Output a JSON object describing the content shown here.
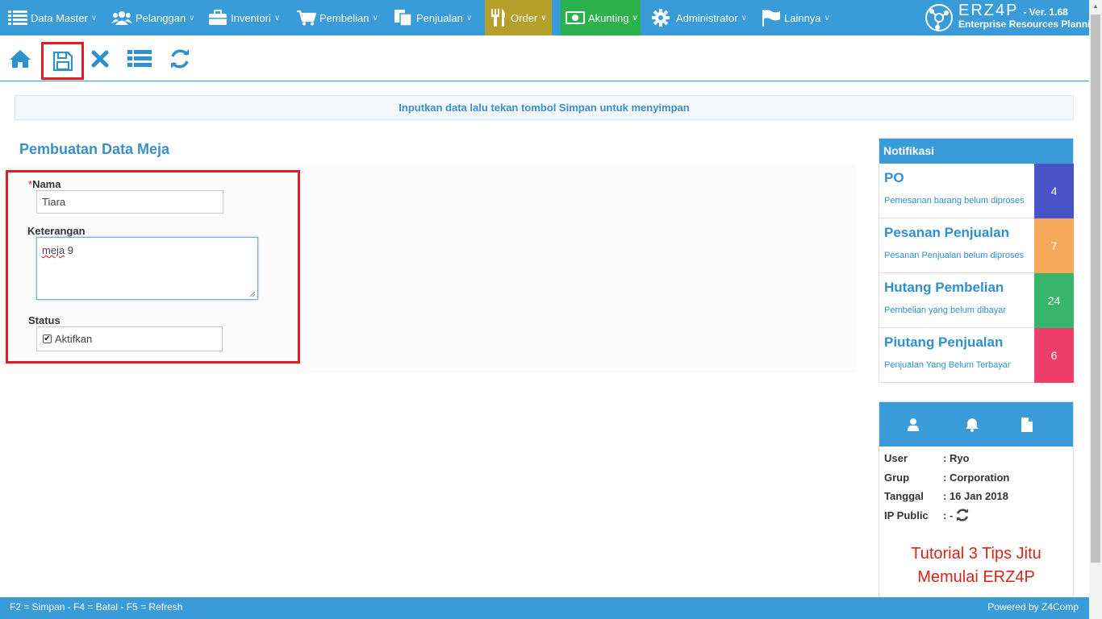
{
  "nav": {
    "items": [
      {
        "label": "Data Master"
      },
      {
        "label": "Pelanggan"
      },
      {
        "label": "Inventori"
      },
      {
        "label": "Pembelian"
      },
      {
        "label": "Penjualan"
      },
      {
        "label": "Order"
      },
      {
        "label": "Akunting"
      },
      {
        "label": "Administrator"
      },
      {
        "label": "Lainnya"
      }
    ],
    "colors": {
      "bar": "#3a9bd9",
      "order": "#b5a02a",
      "akunting": "#2bb24c"
    }
  },
  "brand": {
    "name": "ERZ4P",
    "version": "- Ver. 1.68",
    "subtitle": "Enterprise Resources Planning"
  },
  "toolbar": {
    "icons": [
      "home-icon",
      "save-icon",
      "cancel-icon",
      "list-icon",
      "refresh-icon"
    ]
  },
  "info_message": "Inputkan data lalu tekan tombol Simpan untuk menyimpan",
  "page_title": "Pembuatan Data Meja",
  "form": {
    "nama_required_mark": "*",
    "nama_label": "Nama",
    "nama_value": "Tiara",
    "keterangan_label": "Keterangan",
    "keterangan_value_word": "meja",
    "keterangan_value_rest": " 9",
    "status_label": "Status",
    "status_checkbox_label": "Aktifkan",
    "status_checked": true
  },
  "notifications": {
    "title": "Notifikasi",
    "items": [
      {
        "title": "PO",
        "desc": "Pemesanan barang belum diproses",
        "count": "4",
        "color": "#4a52c8"
      },
      {
        "title": "Pesanan Penjualan",
        "desc": "Pesanan Penjualan belum diproses",
        "count": "7",
        "color": "#f7a95b"
      },
      {
        "title": "Hutang Pembelian",
        "desc": "Pembelian yang belum dibayar",
        "count": "24",
        "color": "#36b56b"
      },
      {
        "title": "Piutang Penjualan",
        "desc": "Penjualan Yang Belum Terbayar",
        "count": "6",
        "color": "#ee3f6c"
      }
    ]
  },
  "user_info": {
    "user_label": "User",
    "user_value": ": Ryo",
    "grup_label": "Grup",
    "grup_value": ": Corporation",
    "tanggal_label": "Tanggal",
    "tanggal_value": ": 16 Jan 2018",
    "ip_label": "IP Public",
    "ip_value": ": -",
    "tutorial_line1": "Tutorial 3 Tips Jitu",
    "tutorial_line2": "Memulai ERZ4P"
  },
  "footer": {
    "shortcuts": "F2 = Simpan - F4 = Batal - F5 = Refresh",
    "powered": "Powered by Z4Comp"
  }
}
